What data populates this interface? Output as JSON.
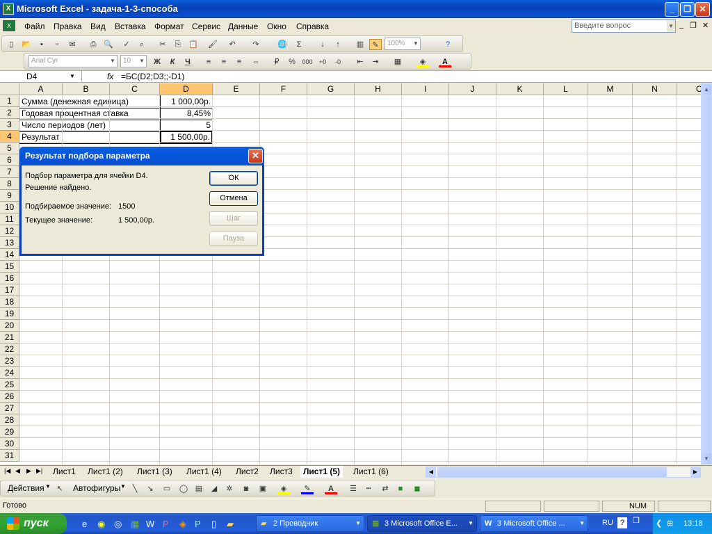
{
  "window": {
    "title": "Microsoft Excel - задача-1-3-способа"
  },
  "menu": {
    "items": [
      "Файл",
      "Правка",
      "Вид",
      "Вставка",
      "Формат",
      "Сервис",
      "Данные",
      "Окно",
      "Справка"
    ],
    "ask_placeholder": "Введите вопрос"
  },
  "toolbar": {
    "zoom": "100%",
    "font_name": "Arial Cyr",
    "font_size": "10",
    "bold": "Ж",
    "italic": "К",
    "underline": "Ч",
    "percent": "%",
    "thousands": "000"
  },
  "formula_bar": {
    "name_box": "D4",
    "fx": "fx",
    "formula": "=БС(D2;D3;;-D1)"
  },
  "sheet": {
    "columns": [
      "A",
      "B",
      "C",
      "D",
      "E",
      "F",
      "G",
      "H",
      "I",
      "J",
      "K",
      "L",
      "M",
      "N",
      "O"
    ],
    "rows": [
      "1",
      "2",
      "3",
      "4",
      "5",
      "6",
      "7",
      "8",
      "9",
      "10",
      "11",
      "12",
      "13",
      "14",
      "15",
      "16",
      "17",
      "18",
      "19",
      "20",
      "21",
      "22",
      "23",
      "24",
      "25",
      "26",
      "27",
      "28",
      "29",
      "30",
      "31"
    ],
    "cells": [
      {
        "label": "Сумма (денежная единица)",
        "value": "1 000,00р."
      },
      {
        "label": "Годовая процентная ставка",
        "value": "8,45%"
      },
      {
        "label": "Число периодов (лет)",
        "value": "5"
      },
      {
        "label": "Результат",
        "value": "1 500,00р."
      }
    ]
  },
  "tabs": [
    "Лист1",
    "Лист1 (2)",
    "Лист1 (3)",
    "Лист1 (4)",
    "Лист2",
    "Лист3",
    "Лист1 (5)",
    "Лист1 (6)"
  ],
  "active_tab": "Лист1 (5)",
  "drawing": {
    "actions": "Действия",
    "autoshapes": "Автофигуры"
  },
  "status": {
    "ready": "Готово",
    "num": "NUM"
  },
  "dialog": {
    "title": "Результат подбора параметра",
    "line1": "Подбор параметра для ячейки D4.",
    "line2": "Решение найдено.",
    "target_label": "Подбираемое значение:",
    "target_value": "1500",
    "current_label": "Текущее значение:",
    "current_value": "1 500,00р.",
    "ok": "ОК",
    "cancel": "Отмена",
    "step": "Шаг",
    "pause": "Пауза"
  },
  "taskbar": {
    "start": "пуск",
    "buttons": [
      "2 Проводник",
      "3 Microsoft Office E...",
      "3 Microsoft Office ..."
    ],
    "lang": "RU",
    "clock": "13:18"
  },
  "colors": {
    "title_blue": "#0a5ed9",
    "selection_header": "#ffc671",
    "taskbar_blue": "#245edb",
    "start_green": "#31a531"
  }
}
